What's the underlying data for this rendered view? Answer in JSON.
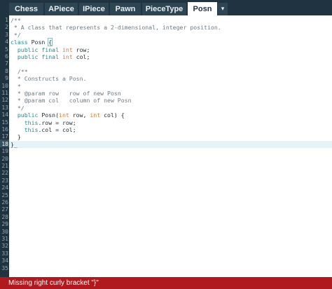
{
  "tabs": [
    {
      "label": "Chess",
      "active": false
    },
    {
      "label": "APiece",
      "active": false
    },
    {
      "label": "IPiece",
      "active": false
    },
    {
      "label": "Pawn",
      "active": false
    },
    {
      "label": "PieceType",
      "active": false
    },
    {
      "label": "Posn",
      "active": true
    }
  ],
  "tab_menu_icon": "▾",
  "editor": {
    "current_line": 18,
    "line_numbers": [
      "1",
      "2",
      "3",
      "4",
      "5",
      "6",
      "7",
      "8",
      "9",
      "10",
      "11",
      "12",
      "13",
      "14",
      "15",
      "16",
      "17",
      "18",
      "19",
      "20",
      "21",
      "22",
      "23",
      "24",
      "25",
      "26",
      "27",
      "28",
      "29",
      "30",
      "31",
      "32",
      "33",
      "34",
      "35"
    ],
    "code": [
      "/**",
      " * A class that represents a 2-dimensional, integer position.",
      " */",
      "class Posn {",
      "  public final int row;",
      "  public final int col;",
      "",
      "  /**",
      "  * Constructs a Posn.",
      "  *",
      "  * @param row   row of new Posn",
      "  * @param col   column of new Posn",
      "  */",
      "  public Posn(int row, int col) {",
      "    this.row = row;",
      "    this.col = col;",
      "  }",
      "}_"
    ]
  },
  "status": {
    "message": "Missing right curly bracket \"}\""
  },
  "colors": {
    "chrome": "#1f3440",
    "tab": "#2e4654",
    "keyword": "#2a8a8e",
    "type": "#d97b2e",
    "comment": "#6b7b84",
    "error": "#b0191e"
  }
}
